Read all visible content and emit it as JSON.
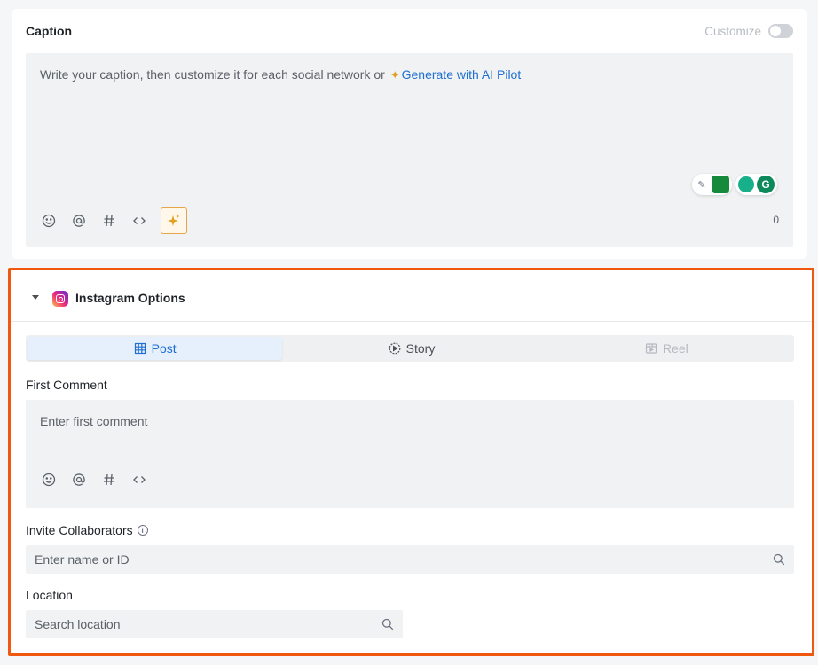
{
  "caption": {
    "title": "Caption",
    "customize_label": "Customize",
    "placeholder_prefix": "Write your caption, then customize it for each social network or",
    "ai_link": "Generate with AI Pilot",
    "char_count": "0",
    "toolbar": [
      "emoji-icon",
      "mention-icon",
      "hashtag-icon",
      "code-icon",
      "ai-sparkle-icon"
    ]
  },
  "instagram": {
    "title": "Instagram Options",
    "tabs": [
      {
        "label": "Post",
        "state": "active"
      },
      {
        "label": "Story",
        "state": "normal"
      },
      {
        "label": "Reel",
        "state": "disabled"
      }
    ],
    "first_comment": {
      "label": "First Comment",
      "placeholder": "Enter first comment"
    },
    "collaborators": {
      "label": "Invite Collaborators",
      "placeholder": "Enter name or ID"
    },
    "location": {
      "label": "Location",
      "placeholder": "Search location"
    }
  },
  "colors": {
    "accent": "#1f6fd1",
    "highlight_border": "#f1580f",
    "ai_gold": "#e0a020"
  }
}
